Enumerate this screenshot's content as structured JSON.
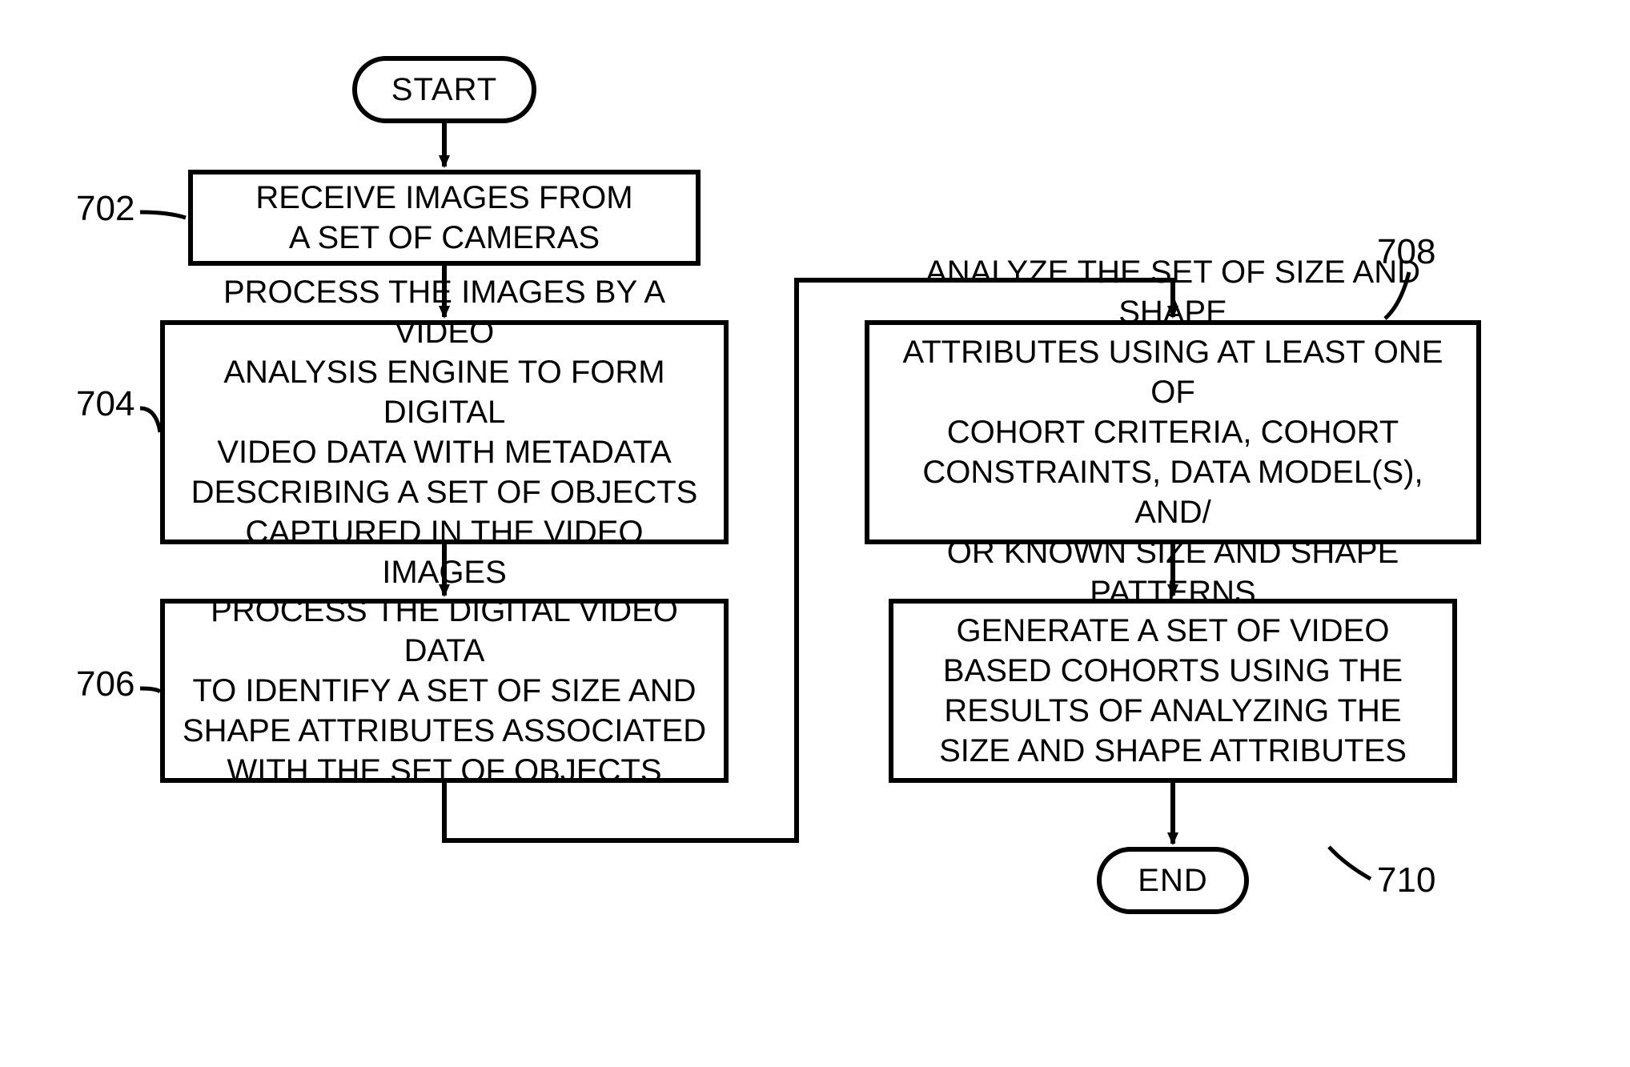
{
  "terminators": {
    "start": "START",
    "end": "END"
  },
  "refs": {
    "r702": "702",
    "r704": "704",
    "r706": "706",
    "r708": "708",
    "r710": "710"
  },
  "boxes": {
    "b702": "RECEIVE IMAGES FROM\nA SET OF CAMERAS",
    "b704": "PROCESS THE IMAGES BY A VIDEO\nANALYSIS ENGINE TO FORM DIGITAL\nVIDEO DATA WITH METADATA\nDESCRIBING A SET OF OBJECTS\nCAPTURED IN THE VIDEO IMAGES",
    "b706": "PROCESS THE DIGITAL VIDEO DATA\nTO IDENTIFY A SET OF SIZE AND\nSHAPE ATTRIBUTES ASSOCIATED\nWITH THE SET OF OBJECTS",
    "b708": "ANALYZE THE SET OF SIZE AND SHAPE\nATTRIBUTES USING AT LEAST ONE OF\nCOHORT CRITERIA, COHORT\nCONSTRAINTS, DATA MODEL(S), AND/\nOR KNOWN SIZE AND SHAPE PATTERNS",
    "b710": "GENERATE A SET OF VIDEO\nBASED COHORTS USING THE\nRESULTS OF ANALYZING THE\nSIZE AND SHAPE ATTRIBUTES"
  }
}
